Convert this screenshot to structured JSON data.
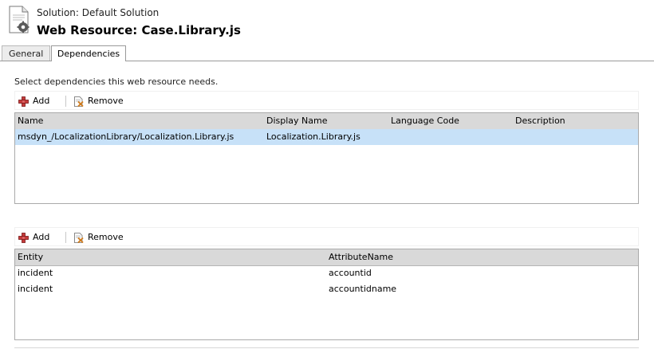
{
  "header": {
    "solution_label": "Solution: Default Solution",
    "title": "Web Resource: Case.Library.js"
  },
  "tabs": [
    {
      "label": "General",
      "active": false
    },
    {
      "label": "Dependencies",
      "active": true
    }
  ],
  "dependencies": {
    "description": "Select dependencies this web resource needs.",
    "toolbar": {
      "add_label": "Add",
      "remove_label": "Remove"
    },
    "columns": [
      "Name",
      "Display Name",
      "Language Code",
      "Description"
    ],
    "rows": [
      {
        "name": "msdyn_/LocalizationLibrary/Localization.Library.js",
        "display_name": "Localization.Library.js",
        "language_code": "",
        "description": "",
        "selected": true
      }
    ]
  },
  "attributes": {
    "toolbar": {
      "add_label": "Add",
      "remove_label": "Remove"
    },
    "columns": [
      "Entity",
      "AttributeName"
    ],
    "rows": [
      {
        "entity": "incident",
        "attribute_name": "accountid"
      },
      {
        "entity": "incident",
        "attribute_name": "accountidname"
      }
    ]
  },
  "colors": {
    "selected_row": "#c7e1f8",
    "header_bg": "#d9d9d9",
    "add_icon": "#a31515"
  },
  "icons": {
    "header": "document-gear-icon",
    "add": "plus-icon",
    "remove": "remove-document-icon"
  }
}
